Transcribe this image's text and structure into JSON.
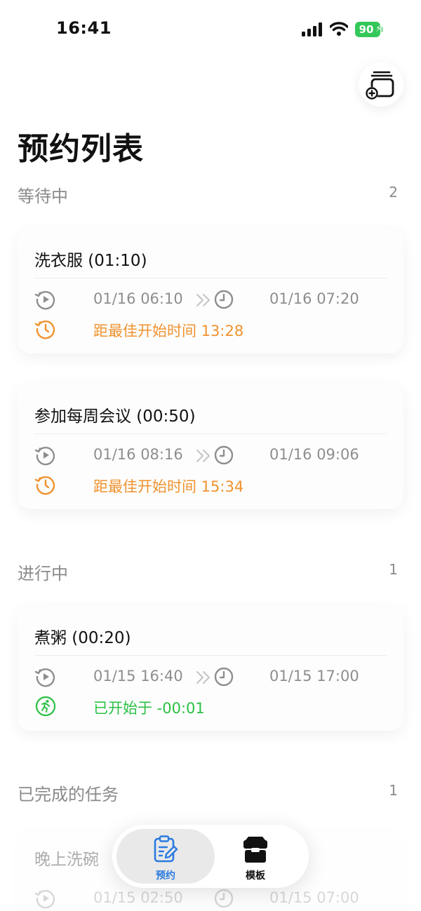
{
  "status_bar": {
    "time": "16:41",
    "battery": "90"
  },
  "header": {
    "title": "预约列表"
  },
  "sections": {
    "waiting": {
      "title": "等待中",
      "count": "2",
      "tasks": [
        {
          "title": "洗衣服  (01:10)",
          "start": "01/16 06:10",
          "end": "01/16 07:20",
          "status": "距最佳开始时间 13:28"
        },
        {
          "title": "参加每周会议  (00:50)",
          "start": "01/16 08:16",
          "end": "01/16 09:06",
          "status": "距最佳开始时间 15:34"
        }
      ]
    },
    "in_progress": {
      "title": "进行中",
      "count": "1",
      "tasks": [
        {
          "title": "煮粥  (00:20)",
          "start": "01/15 16:40",
          "end": "01/15 17:00",
          "status": "已开始于 -00:01"
        }
      ]
    },
    "completed": {
      "title": "已完成的任务",
      "count": "1",
      "tasks": [
        {
          "title": "晚上洗碗",
          "start": "01/15 02:50",
          "end": "01/15 07:00"
        }
      ]
    }
  },
  "tab_bar": {
    "tabs": [
      {
        "label": "预约",
        "icon": "clipboard-edit-icon",
        "active": true
      },
      {
        "label": "模板",
        "icon": "archive-box-icon",
        "active": false
      }
    ]
  },
  "colors": {
    "accent": "#2a7be0",
    "waiting": "#f0922e",
    "running": "#2bc045",
    "battery": "#34c759"
  }
}
